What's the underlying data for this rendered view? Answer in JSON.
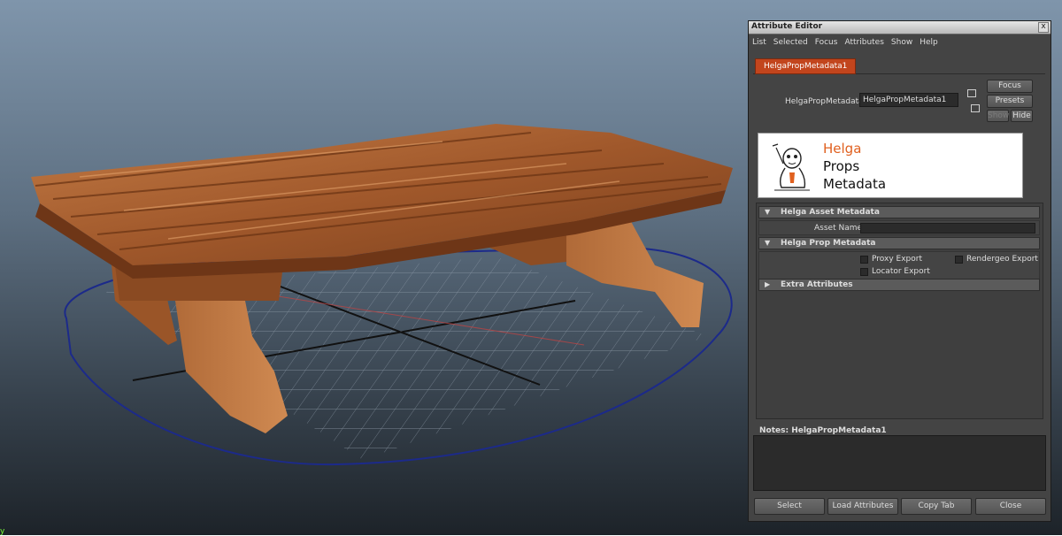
{
  "viewport": {
    "axis_label": "y"
  },
  "window": {
    "title": "Attribute Editor",
    "close_glyph": "x"
  },
  "menu": [
    "List",
    "Selected",
    "Focus",
    "Attributes",
    "Show",
    "Help"
  ],
  "tab": {
    "label": "HelgaPropMetadata1"
  },
  "node": {
    "label": "HelgaPropMetadata:",
    "value": "HelgaPropMetadata1"
  },
  "side_buttons": {
    "focus": "Focus",
    "presets": "Presets",
    "show": "Show",
    "hide": "Hide"
  },
  "logo": {
    "line1": "Helga",
    "line2": "Props",
    "line3": "Metadata",
    "accent_color": "#e0601f"
  },
  "sections": {
    "asset": {
      "title": "Helga Asset Metadata",
      "asset_name_label": "Asset Name",
      "asset_name_value": ""
    },
    "prop": {
      "title": "Helga Prop Metadata",
      "proxy_export": "Proxy Export",
      "rendergeo_export": "Rendergeo Export",
      "locator_export": "Locator Export"
    },
    "extra": {
      "title": "Extra Attributes"
    }
  },
  "notes": {
    "label": "Notes:  HelgaPropMetadata1",
    "text": ""
  },
  "bottom_buttons": {
    "select": "Select",
    "load_attributes": "Load Attributes",
    "copy_tab": "Copy Tab",
    "close": "Close"
  }
}
